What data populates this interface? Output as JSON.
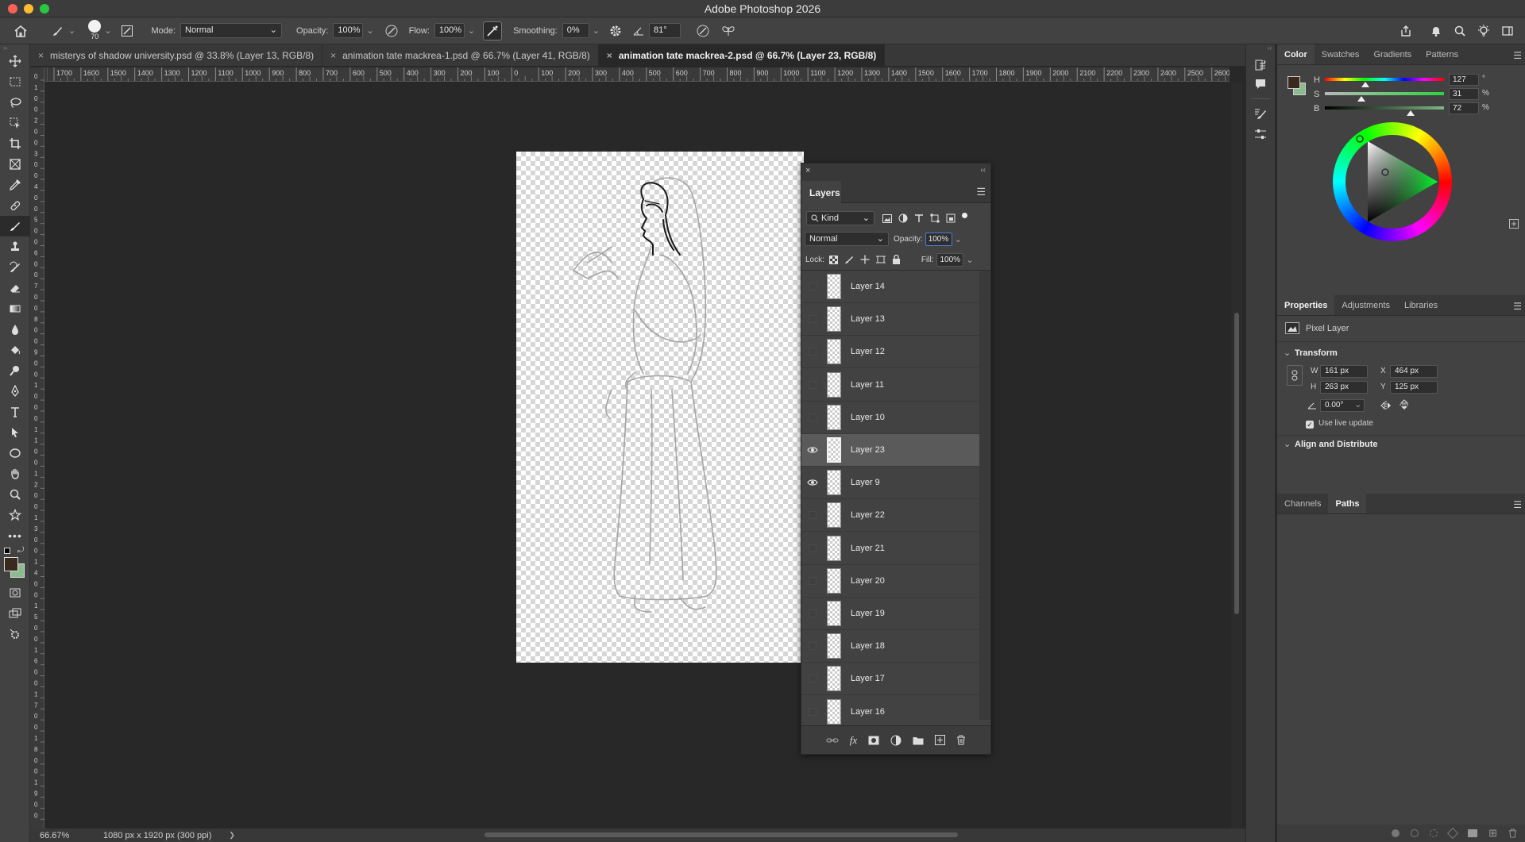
{
  "app": {
    "title": "Adobe Photoshop 2026"
  },
  "options_bar": {
    "brush_size": "70",
    "mode_label": "Mode:",
    "mode_value": "Normal",
    "opacity_label": "Opacity:",
    "opacity_value": "100%",
    "flow_label": "Flow:",
    "flow_value": "100%",
    "smoothing_label": "Smoothing:",
    "smoothing_value": "0%",
    "angle_value": "81°"
  },
  "tabs": [
    {
      "label": "misterys of shadow university.psd @ 33.8% (Layer 13, RGB/8)"
    },
    {
      "label": "animation tate mackrea-1.psd @ 66.7% (Layer 41, RGB/8)"
    },
    {
      "label": "animation tate mackrea-2.psd @ 66.7% (Layer 23, RGB/8)"
    }
  ],
  "ruler": {
    "h_ticks": [
      "1700",
      "1600",
      "1500",
      "1400",
      "1300",
      "1200",
      "1100",
      "1000",
      "900",
      "800",
      "700",
      "600",
      "500",
      "400",
      "300",
      "200",
      "100",
      "0",
      "100",
      "200",
      "300",
      "400",
      "500",
      "600",
      "700",
      "800",
      "900",
      "1000",
      "1100",
      "1200",
      "1300",
      "1400",
      "1500",
      "1600",
      "1700",
      "1800",
      "1900",
      "2000",
      "2100",
      "2200",
      "2300",
      "2400",
      "2500",
      "2600"
    ],
    "v_ticks": [
      "0",
      "1",
      "0",
      "0",
      "2",
      "0",
      "0",
      "3",
      "0",
      "0",
      "4",
      "0",
      "0",
      "5",
      "0",
      "0",
      "6",
      "0",
      "0",
      "7",
      "0",
      "0",
      "8",
      "0",
      "0",
      "9",
      "0",
      "0",
      "1",
      "0",
      "0",
      "0",
      "1",
      "1",
      "0",
      "0",
      "1",
      "2",
      "0",
      "0",
      "1",
      "3",
      "0",
      "0",
      "1",
      "4",
      "0",
      "0",
      "1",
      "5",
      "0",
      "0",
      "1",
      "6",
      "0",
      "0",
      "1",
      "7",
      "0",
      "0",
      "1",
      "8",
      "0",
      "0",
      "1",
      "9",
      "0",
      "0"
    ]
  },
  "status": {
    "zoom": "66.67%",
    "doc_info": "1080 px x 1920 px (300 ppi)",
    "arrow": "❯"
  },
  "layers_panel": {
    "title": "Layers",
    "filter_kind": "Kind",
    "blend_mode": "Normal",
    "opacity_label": "Opacity:",
    "opacity_value": "100%",
    "lock_label": "Lock:",
    "fill_label": "Fill:",
    "fill_value": "100%",
    "layers": [
      {
        "name": "Layer 14",
        "visible": false,
        "selected": false
      },
      {
        "name": "Layer 13",
        "visible": false,
        "selected": false
      },
      {
        "name": "Layer 12",
        "visible": false,
        "selected": false
      },
      {
        "name": "Layer 11",
        "visible": false,
        "selected": false
      },
      {
        "name": "Layer 10",
        "visible": false,
        "selected": false
      },
      {
        "name": "Layer 23",
        "visible": true,
        "selected": true
      },
      {
        "name": "Layer 9",
        "visible": true,
        "selected": false
      },
      {
        "name": "Layer 22",
        "visible": false,
        "selected": false
      },
      {
        "name": "Layer 21",
        "visible": false,
        "selected": false
      },
      {
        "name": "Layer 20",
        "visible": false,
        "selected": false
      },
      {
        "name": "Layer 19",
        "visible": false,
        "selected": false
      },
      {
        "name": "Layer 18",
        "visible": false,
        "selected": false
      },
      {
        "name": "Layer 17",
        "visible": false,
        "selected": false
      },
      {
        "name": "Layer 16",
        "visible": false,
        "selected": false
      }
    ]
  },
  "color_panel": {
    "tabs": [
      "Color",
      "Swatches",
      "Gradients",
      "Patterns"
    ],
    "h_label": "H",
    "h_value": "127",
    "h_unit": "°",
    "s_label": "S",
    "s_value": "31",
    "s_unit": "%",
    "b_label": "B",
    "b_value": "72",
    "b_unit": "%",
    "foreground_color": "#3a2a1e",
    "background_color": "#8dbb90"
  },
  "properties_panel": {
    "tabs": [
      "Properties",
      "Adjustments",
      "Libraries"
    ],
    "kind": "Pixel Layer",
    "transform_label": "Transform",
    "w_label": "W",
    "w_value": "161 px",
    "h_label": "H",
    "h_value": "263 px",
    "x_label": "X",
    "x_value": "464 px",
    "y_label": "Y",
    "y_value": "125 px",
    "angle_value": "0.00°",
    "live_update_label": "Use live update",
    "align_label": "Align and Distribute"
  },
  "paths_panel": {
    "tabs": [
      "Channels",
      "Paths"
    ]
  }
}
